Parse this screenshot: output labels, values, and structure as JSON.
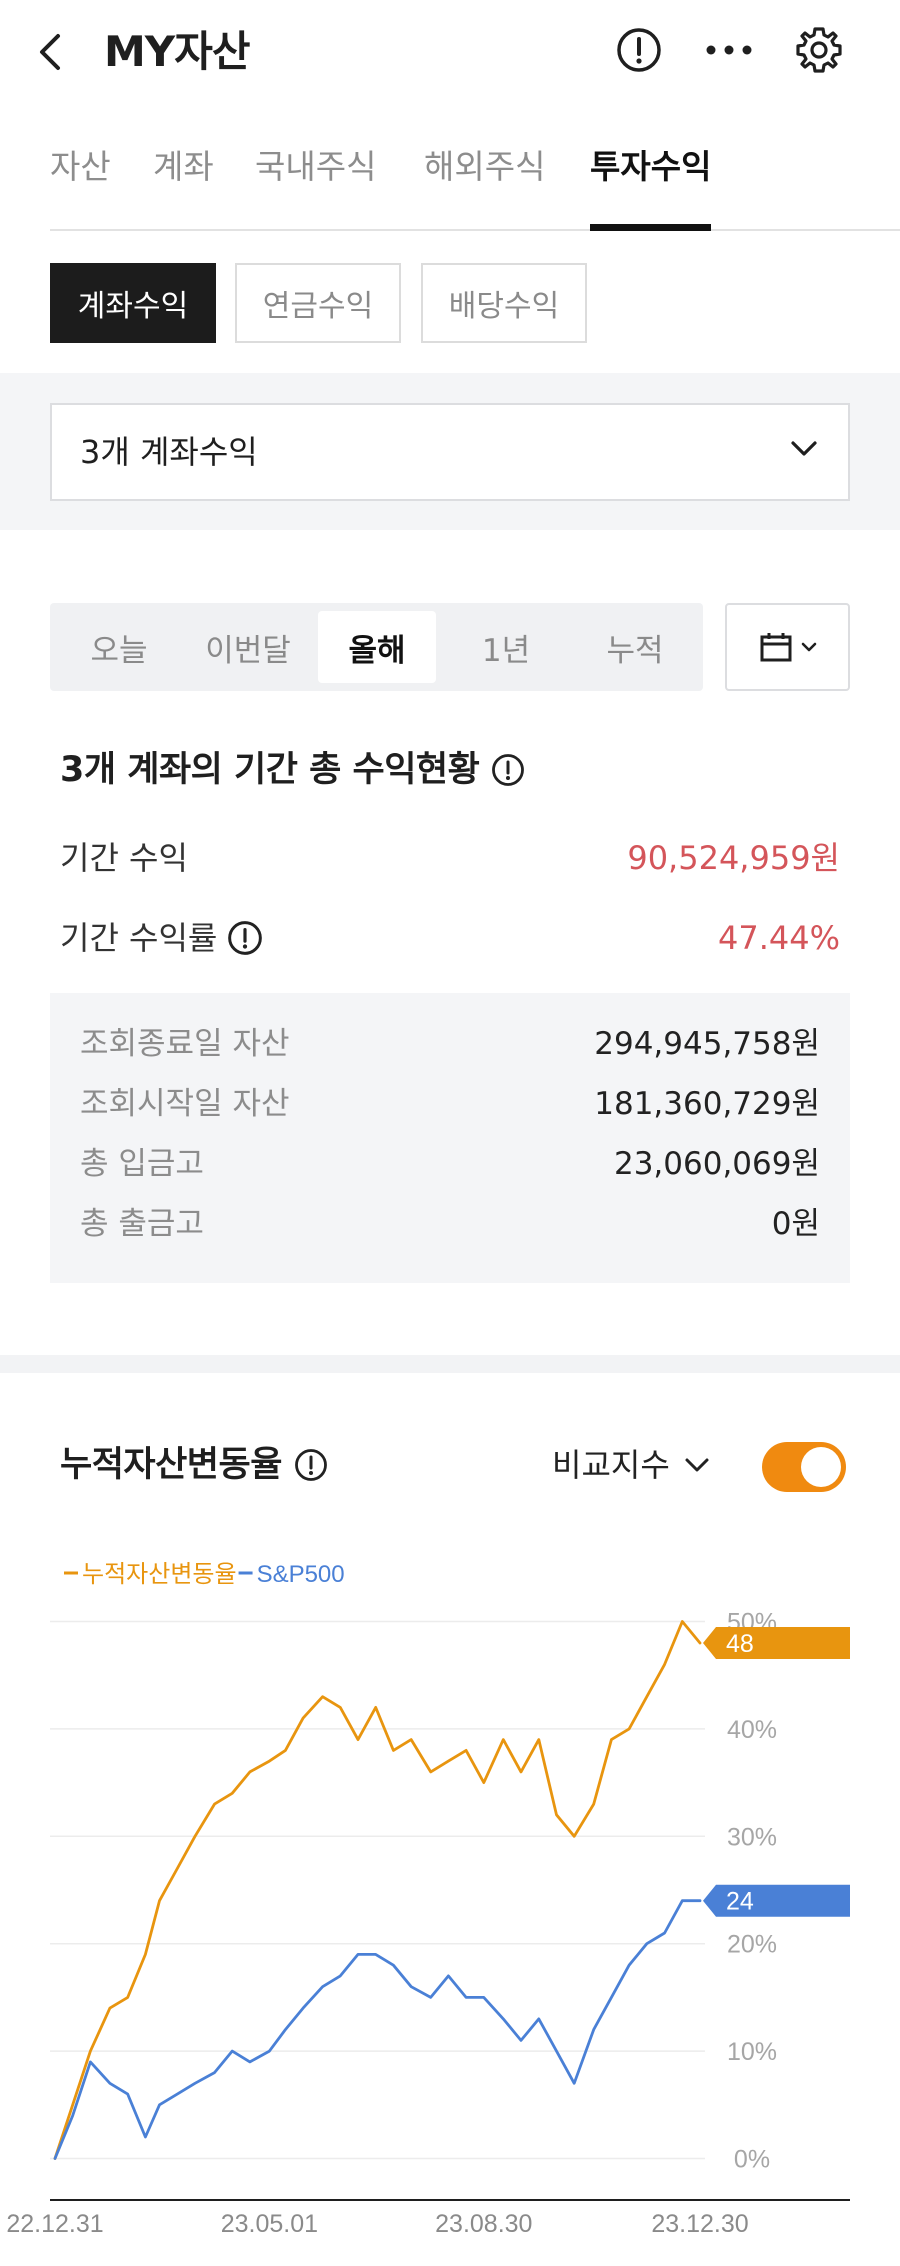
{
  "header": {
    "title": "MY자산",
    "icons": [
      "chevron-left-icon",
      "info-circle-icon",
      "more-icon",
      "gear-icon"
    ]
  },
  "main_tabs": [
    {
      "label": "자산",
      "active": false
    },
    {
      "label": "계좌",
      "active": false
    },
    {
      "label": "국내주식",
      "active": false
    },
    {
      "label": "해외주식",
      "active": false
    },
    {
      "label": "투자수익",
      "active": true
    }
  ],
  "sub_tabs": [
    {
      "label": "계좌수익",
      "active": true
    },
    {
      "label": "연금수익",
      "active": false
    },
    {
      "label": "배당수익",
      "active": false
    }
  ],
  "account_select": {
    "value": "3개 계좌수익"
  },
  "period_tabs": [
    {
      "label": "오늘",
      "active": false
    },
    {
      "label": "이번달",
      "active": false
    },
    {
      "label": "올해",
      "active": true
    },
    {
      "label": "1년",
      "active": false
    },
    {
      "label": "누적",
      "active": false
    }
  ],
  "summary": {
    "title": "3개 계좌의 기간 총 수익현황",
    "period_profit_label": "기간 수익",
    "period_profit_value": "90,524,959원",
    "period_rate_label": "기간 수익률",
    "period_rate_value": "47.44%",
    "accent_color": "#d4555a",
    "details": [
      {
        "label": "조회종료일 자산",
        "value": "294,945,758원"
      },
      {
        "label": "조회시작일 자산",
        "value": "181,360,729원"
      },
      {
        "label": "총 입금고",
        "value": "23,060,069원"
      },
      {
        "label": "총 출금고",
        "value": "0원"
      }
    ]
  },
  "chart_section": {
    "title": "누적자산변동율",
    "compare_label": "비교지수",
    "compare_toggle_on": true
  },
  "chart_data": {
    "type": "line",
    "x_tick_labels": [
      "22.12.31",
      "23.05.01",
      "23.08.30",
      "23.12.30"
    ],
    "y_tick_labels": [
      "0%",
      "10%",
      "20%",
      "30%",
      "40%",
      "50%"
    ],
    "ylim": [
      -2,
      52
    ],
    "grid": true,
    "legend_placement": "top-left",
    "series": [
      {
        "name": "누적자산변동율",
        "color": "#e8950f",
        "end_label": "48",
        "x": [
          "22.12.31",
          "23.01.10",
          "23.01.20",
          "23.01.31",
          "23.02.10",
          "23.02.20",
          "23.02.28",
          "23.03.10",
          "23.03.20",
          "23.03.31",
          "23.04.10",
          "23.04.20",
          "23.05.01",
          "23.05.10",
          "23.05.20",
          "23.05.31",
          "23.06.10",
          "23.06.20",
          "23.06.30",
          "23.07.10",
          "23.07.20",
          "23.07.31",
          "23.08.10",
          "23.08.20",
          "23.08.30",
          "23.09.10",
          "23.09.20",
          "23.09.30",
          "23.10.10",
          "23.10.20",
          "23.10.31",
          "23.11.10",
          "23.11.20",
          "23.11.30",
          "23.12.10",
          "23.12.20",
          "23.12.30"
        ],
        "values": [
          0,
          5,
          10,
          14,
          15,
          19,
          24,
          27,
          30,
          33,
          34,
          36,
          37,
          38,
          41,
          43,
          42,
          39,
          42,
          38,
          39,
          36,
          37,
          38,
          35,
          39,
          36,
          39,
          32,
          30,
          33,
          39,
          40,
          43,
          46,
          50,
          48
        ]
      },
      {
        "name": "S&P500",
        "color": "#4a80d6",
        "end_label": "24",
        "x": [
          "22.12.31",
          "23.01.10",
          "23.01.20",
          "23.01.31",
          "23.02.10",
          "23.02.20",
          "23.02.28",
          "23.03.10",
          "23.03.20",
          "23.03.31",
          "23.04.10",
          "23.04.20",
          "23.05.01",
          "23.05.10",
          "23.05.20",
          "23.05.31",
          "23.06.10",
          "23.06.20",
          "23.06.30",
          "23.07.10",
          "23.07.20",
          "23.07.31",
          "23.08.10",
          "23.08.20",
          "23.08.30",
          "23.09.10",
          "23.09.20",
          "23.09.30",
          "23.10.10",
          "23.10.20",
          "23.10.31",
          "23.11.10",
          "23.11.20",
          "23.11.30",
          "23.12.10",
          "23.12.20",
          "23.12.30"
        ],
        "values": [
          0,
          4,
          9,
          7,
          6,
          2,
          5,
          6,
          7,
          8,
          10,
          9,
          10,
          12,
          14,
          16,
          17,
          19,
          19,
          18,
          16,
          15,
          17,
          15,
          15,
          13,
          11,
          13,
          10,
          7,
          12,
          15,
          18,
          20,
          21,
          24,
          24
        ]
      }
    ]
  }
}
